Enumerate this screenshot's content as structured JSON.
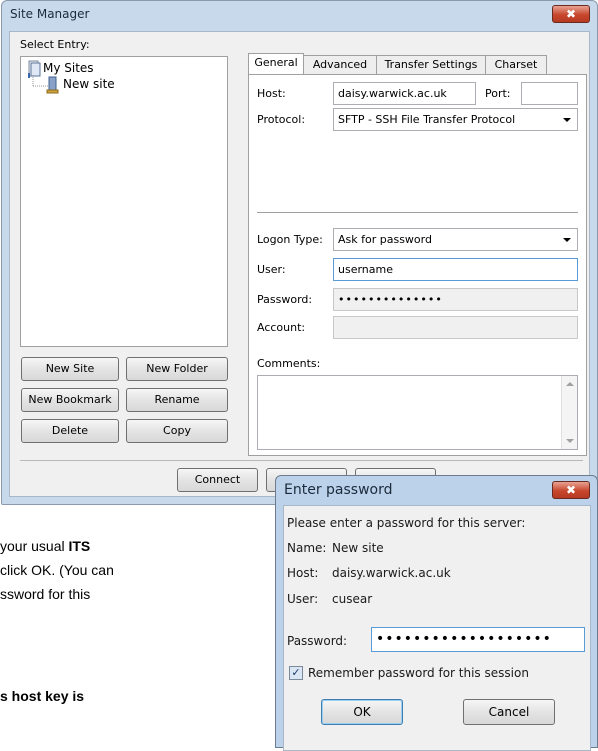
{
  "site_manager": {
    "title": "Site Manager",
    "close_glyph": "✖",
    "select_entry_label": "Select Entry:",
    "tree": {
      "root": "My Sites",
      "child": "New site"
    },
    "buttons": {
      "new_site": "New Site",
      "new_folder": "New Folder",
      "new_bookmark": "New Bookmark",
      "rename": "Rename",
      "delete": "Delete",
      "copy": "Copy",
      "connect": "Connect"
    },
    "tabs": [
      "General",
      "Advanced",
      "Transfer Settings",
      "Charset"
    ],
    "general": {
      "host_label": "Host:",
      "host_value": "daisy.warwick.ac.uk",
      "port_label": "Port:",
      "port_value": "",
      "protocol_label": "Protocol:",
      "protocol_value": "SFTP - SSH File Transfer Protocol",
      "logon_type_label": "Logon Type:",
      "logon_type_value": "Ask for password",
      "user_label": "User:",
      "user_value": "username",
      "password_label": "Password:",
      "password_value": "••••••••••••••",
      "account_label": "Account:",
      "account_value": "",
      "comments_label": "Comments:",
      "comments_value": ""
    }
  },
  "password_dialog": {
    "title": "Enter password",
    "close_glyph": "✖",
    "prompt": "Please enter a password for this server:",
    "name_label": "Name:",
    "name_value": "New site",
    "host_label": "Host:",
    "host_value": "daisy.warwick.ac.uk",
    "user_label": "User:",
    "user_value": "cusear",
    "password_label": "Password:",
    "password_value": "•••••••••••••••••••",
    "remember_label": "Remember password for this session",
    "remember_checked": true,
    "ok_label": "OK",
    "cancel_label": "Cancel"
  },
  "document": {
    "line1_prefix": "your usual ",
    "line1_bold": "ITS",
    "line2": "click OK.  (You can",
    "line3": "ssword for this",
    "line4": "s host key is"
  }
}
